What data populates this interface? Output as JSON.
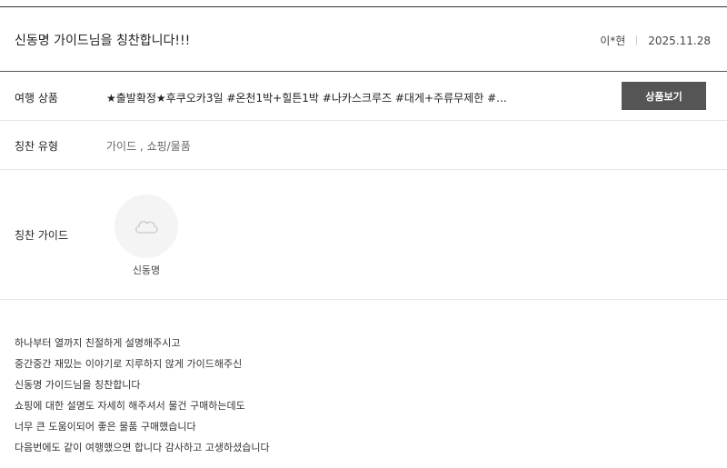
{
  "review": {
    "title": "신동명 가이드님을 칭찬합니다!!!",
    "author": "이*현",
    "date": "2025.11.28"
  },
  "product": {
    "label": "여행 상품",
    "value": "★출발확정★후쿠오카3일 #온천1박+힐튼1박 #나카스크루즈 #대게+주류무제한 #...",
    "button_label": "상품보기"
  },
  "praise_type": {
    "label": "칭찬 유형",
    "value": "가이드 , 쇼핑/물품"
  },
  "praise_guide": {
    "label": "칭찬 가이드",
    "avatar_icon": "cloud-placeholder-icon",
    "name": "신동명"
  },
  "body_lines": [
    "하나부터 열까지 친절하게 설명해주시고",
    "중간중간 재밌는 이야기로 지루하지 않게 가이드해주신",
    "신동명 가이드님을 칭찬합니다",
    "쇼핑에 대한 설명도 자세히 해주셔서 물건 구매하는데도",
    "너무 큰 도움이되어 좋은 물품 구매했습니다",
    "다음번에도 같이 여행했으면 합니다 감사하고 고생하셨습니다"
  ]
}
